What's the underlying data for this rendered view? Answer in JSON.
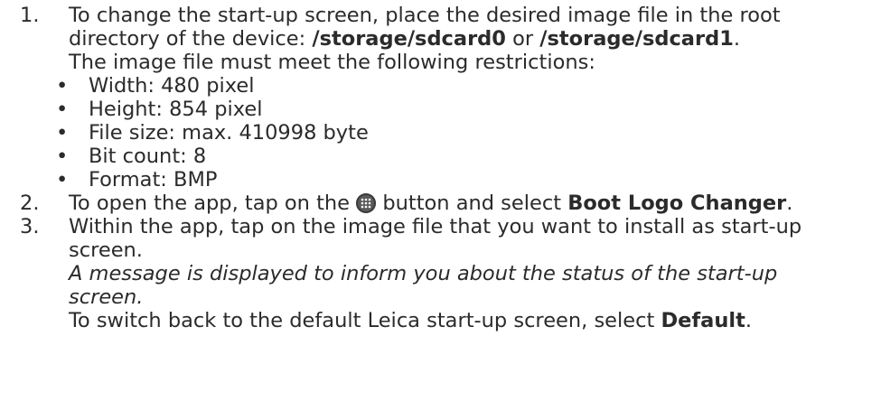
{
  "steps": [
    {
      "number": "1.",
      "line1_pre": "To change the start-up screen, place the desired image file in the root",
      "line2_pre": "directory of the device: ",
      "path0": "/storage/sdcard0",
      "or": " or ",
      "path1": "/storage/sdcard1",
      "line2_post": ".",
      "line3": "The image file must meet the following restrictions:",
      "bullets": [
        "Width: 480 pixel",
        "Height: 854 pixel",
        "File size: max. 410998 byte",
        "Bit count: 8",
        "Format: BMP"
      ]
    },
    {
      "number": "2.",
      "pre": "To open the app, tap on the ",
      "icon": "apps-grid-icon",
      "mid": " button and select ",
      "app_name": "Boot Logo Changer",
      "post": "."
    },
    {
      "number": "3.",
      "line1": "Within the app, tap on the image file that you want to install as start-up",
      "line2": "screen.",
      "result_line1": "A message is displayed to inform you about the status of the start-up",
      "result_line2": "screen.",
      "switch_pre": "To switch back to the default Leica start-up screen, select ",
      "switch_option": "Default",
      "switch_post": "."
    }
  ],
  "bullet_char": "•"
}
